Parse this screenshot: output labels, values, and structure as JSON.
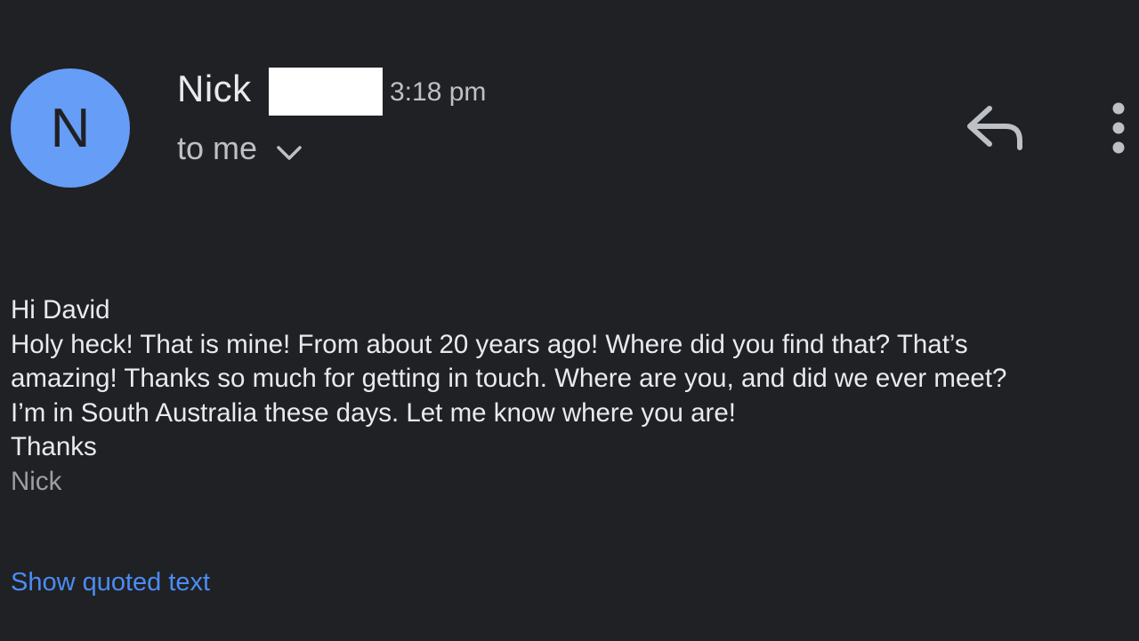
{
  "sender": {
    "avatar_letter": "N",
    "avatar_color": "#669df6",
    "name": "Nick",
    "time": "3:18 pm",
    "recipient_label": "to me"
  },
  "actions": {
    "reply_icon": "reply-icon",
    "more_icon": "more-vertical-icon",
    "details_icon": "chevron-down-icon"
  },
  "message": {
    "lines": [
      "Hi David",
      "Holy heck! That is mine! From about 20 years ago! Where did you find that? That’s",
      "amazing! Thanks so much for getting in touch. Where are you, and did we ever meet?",
      "I’m in South Australia these days. Let me know where you are!",
      "Thanks"
    ],
    "signature": "Nick"
  },
  "show_quoted_label": "Show quoted text",
  "colors": {
    "background": "#202124",
    "link": "#4b8cf5"
  }
}
